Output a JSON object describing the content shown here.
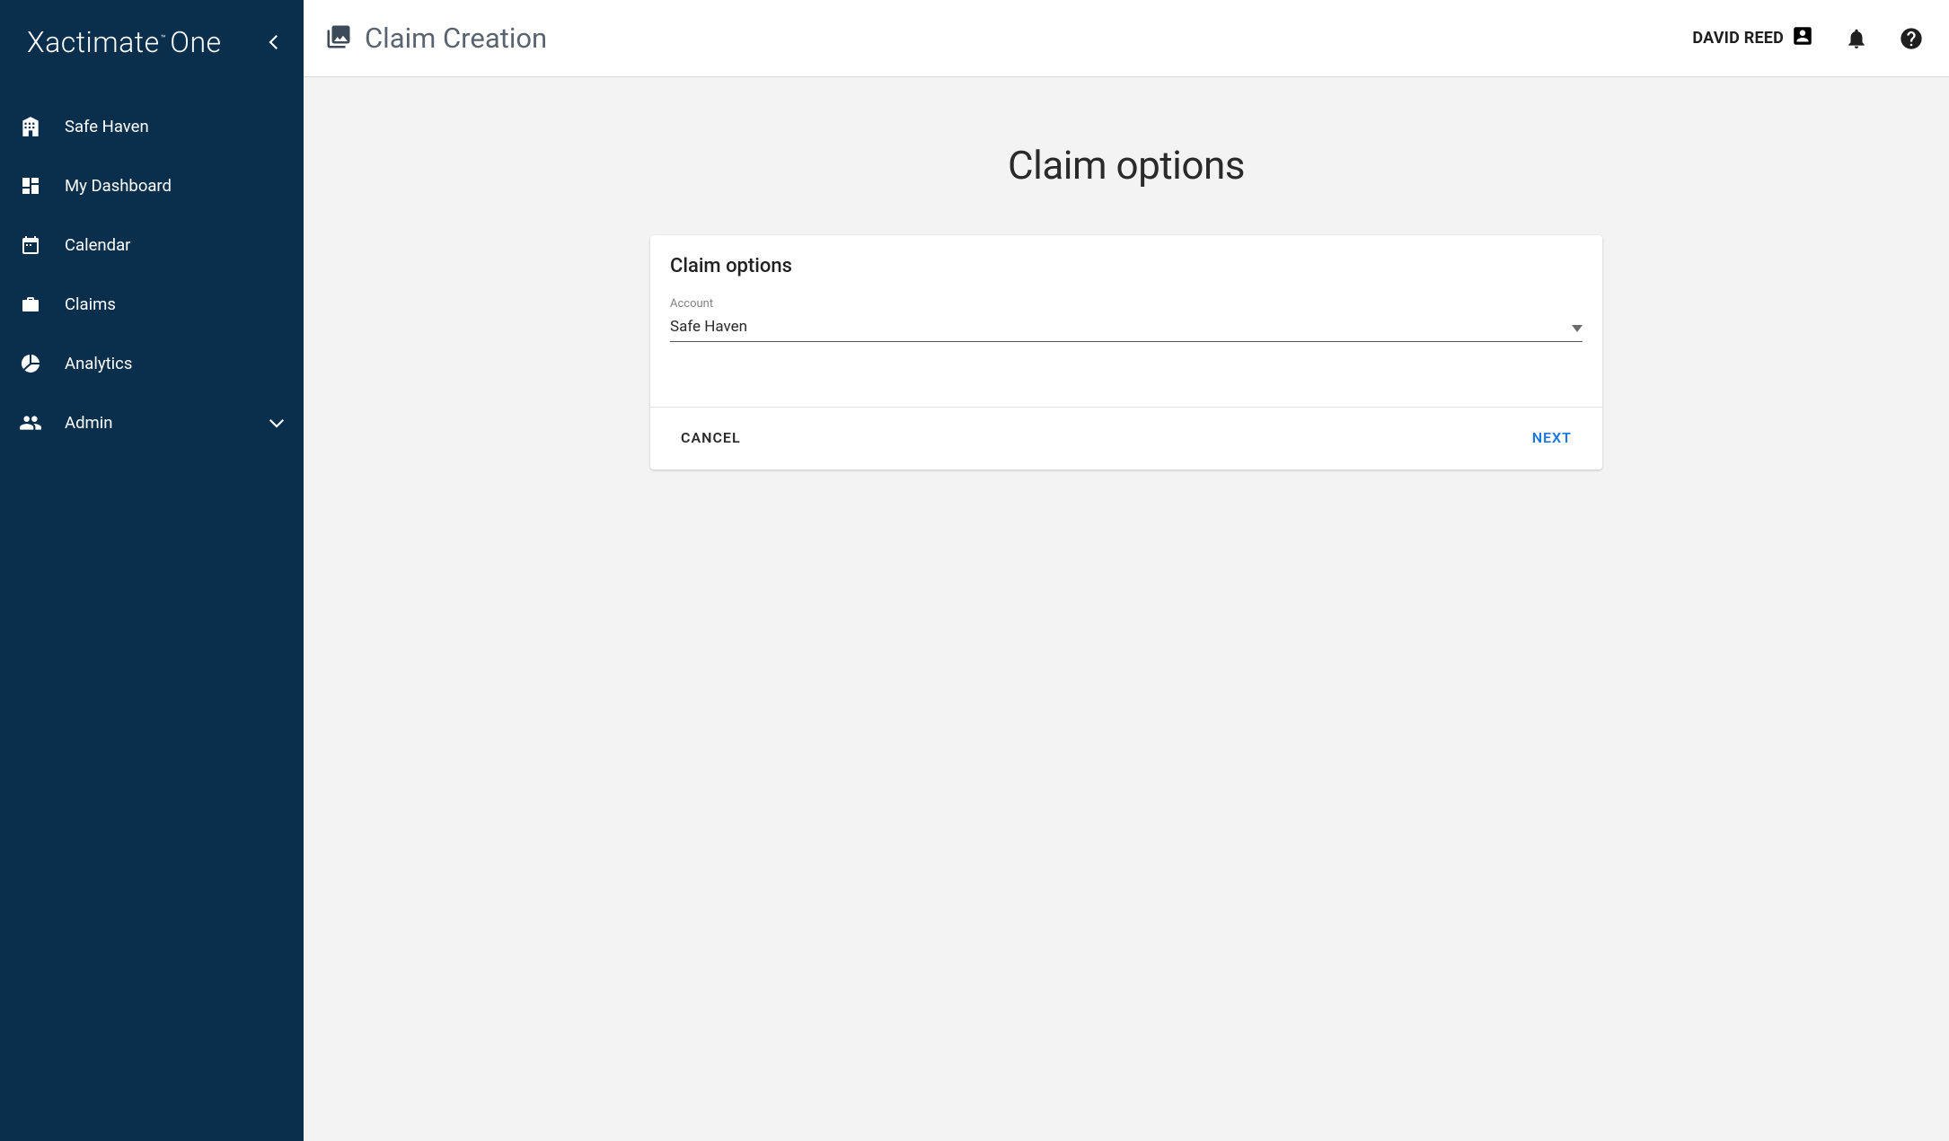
{
  "brand": {
    "name": "Xactimate",
    "tm": "™",
    "sub": "One"
  },
  "sidebar": {
    "items": [
      {
        "label": "Safe Haven"
      },
      {
        "label": "My Dashboard"
      },
      {
        "label": "Calendar"
      },
      {
        "label": "Claims"
      },
      {
        "label": "Analytics"
      },
      {
        "label": "Admin"
      }
    ]
  },
  "header": {
    "title": "Claim Creation",
    "user_name": "DAVID REED"
  },
  "page": {
    "heading": "Claim options",
    "card": {
      "title": "Claim options",
      "field_label": "Account",
      "account_value": "Safe Haven",
      "cancel_label": "CANCEL",
      "next_label": "NEXT"
    }
  }
}
